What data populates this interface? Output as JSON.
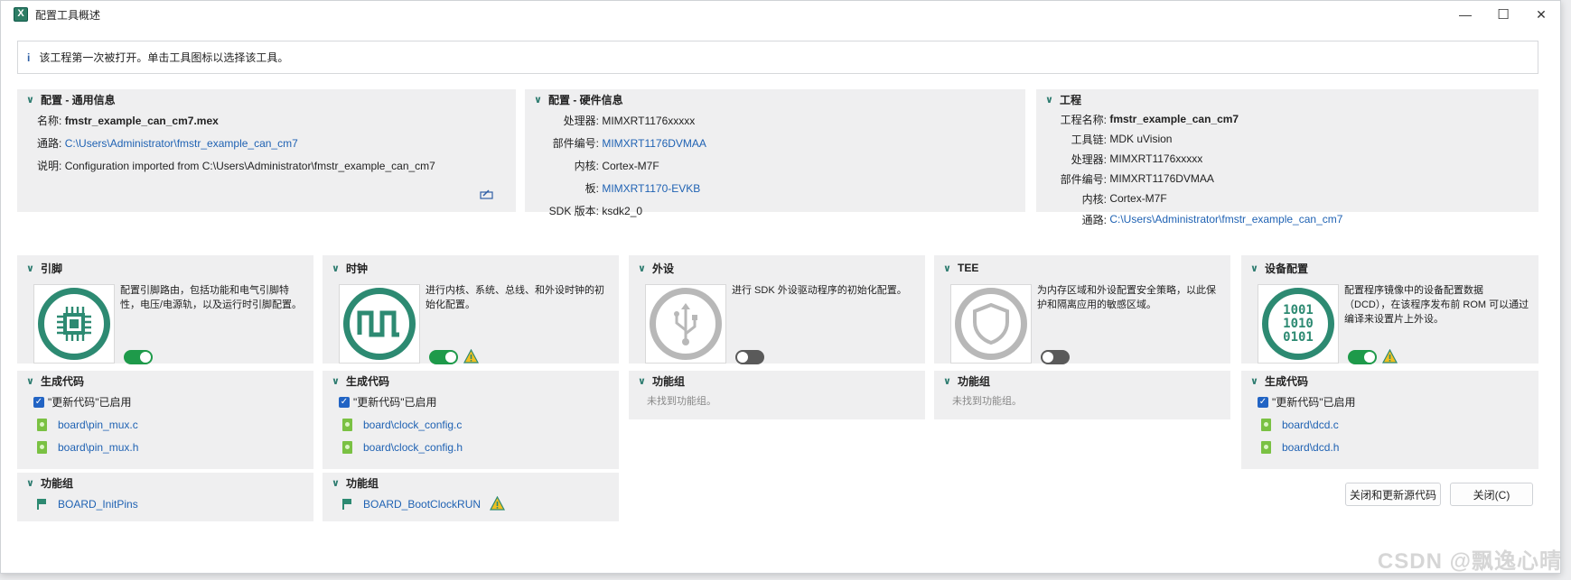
{
  "window": {
    "title": "配置工具概述",
    "icon": "x-app-icon",
    "minimize": "—",
    "maximize": "☐",
    "close": "✕"
  },
  "info": {
    "icon": "info-icon",
    "text": "该工程第一次被打开。单击工具图标以选择该工具。"
  },
  "general": {
    "title": "配置 - 通用信息",
    "name_label": "名称:",
    "name_value": "fmstr_example_can_cm7.mex",
    "path_label": "通路:",
    "path_value": "C:\\Users\\Administrator\\fmstr_example_can_cm7",
    "desc_label": "说明:",
    "desc_value": "Configuration imported from C:\\Users\\Administrator\\fmstr_example_can_cm7"
  },
  "hardware": {
    "title": "配置 - 硬件信息",
    "rows": [
      {
        "label": "处理器:",
        "value": "MIMXRT1176xxxxx",
        "link": false
      },
      {
        "label": "部件编号:",
        "value": "MIMXRT1176DVMAA",
        "link": true
      },
      {
        "label": "内核:",
        "value": "Cortex-M7F",
        "link": false
      },
      {
        "label": "板:",
        "value": "MIMXRT1170-EVKB",
        "link": true
      },
      {
        "label": "SDK 版本:",
        "value": "ksdk2_0",
        "link": false
      }
    ]
  },
  "project": {
    "title": "工程",
    "name_label": "工程名称:",
    "name_value": "fmstr_example_can_cm7",
    "toolchain_label": "工具链:",
    "toolchain_value": "MDK uVision",
    "proc_label": "处理器:",
    "proc_value": "MIMXRT1176xxxxx",
    "part_label": "部件编号:",
    "part_value": "MIMXRT1176DVMAA",
    "core_label": "内核:",
    "core_value": "Cortex-M7F",
    "path_label": "通路:",
    "path_value": "C:\\Users\\Administrator\\fmstr_example_can_cm7"
  },
  "tools": {
    "pins": {
      "title": "引脚",
      "desc": "配置引脚路由，包括功能和电气引脚特性，电压/电源轨，以及运行时引脚配置。",
      "enabled": true
    },
    "clocks": {
      "title": "时钟",
      "desc": "进行内核、系统、总线、和外设时钟的初始化配置。",
      "enabled": true
    },
    "peripherals": {
      "title": "外设",
      "desc": "进行 SDK 外设驱动程序的初始化配置。",
      "enabled": false
    },
    "tee": {
      "title": "TEE",
      "desc": "为内存区域和外设配置安全策略，以此保护和隔离应用的敏感区域。",
      "enabled": false
    },
    "device": {
      "title": "设备配置",
      "desc": "配置程序镜像中的设备配置数据（DCD），在该程序发布前 ROM 可以通过编译来设置片上外设。",
      "enabled": true,
      "chip_text": [
        "1001",
        "1010",
        "0101"
      ]
    }
  },
  "codegen": {
    "title": "生成代码",
    "enabled_label": "\"更新代码\"已启用",
    "pins_files": [
      "board\\pin_mux.c",
      "board\\pin_mux.h"
    ],
    "clocks_files": [
      "board\\clock_config.c",
      "board\\clock_config.h"
    ],
    "device_files": [
      "board\\dcd.c",
      "board\\dcd.h"
    ]
  },
  "funcgroups": {
    "title": "功能组",
    "pins": "BOARD_InitPins",
    "clocks": "BOARD_BootClockRUN",
    "none": "未找到功能组。"
  },
  "buttons": {
    "close_update": "关闭和更新源代码",
    "close": "关闭(C)"
  },
  "watermark": "CSDN @飘逸心晴",
  "colors": {
    "accent": "#2d8a72",
    "link": "#1f62b3",
    "toggle_on": "#1e9a4a"
  }
}
